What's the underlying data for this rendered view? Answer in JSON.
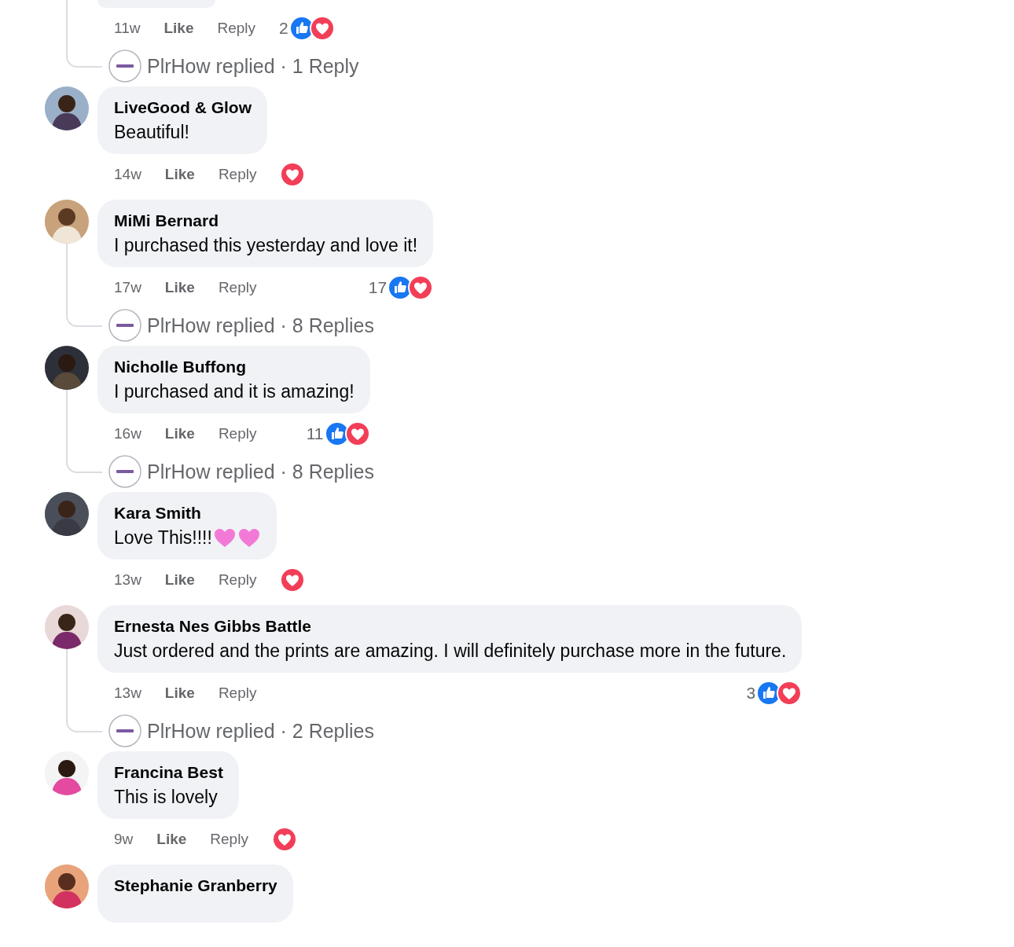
{
  "comments": [
    {
      "time": "11w",
      "actions": [
        "Like",
        "Reply"
      ],
      "reactions": {
        "count": "2",
        "like": true,
        "love": true
      },
      "reply_summary": {
        "text": "PlrHow replied · 1 Reply"
      }
    },
    {
      "name": "LiveGood & Glow",
      "text": "Beautiful!",
      "time": "14w",
      "actions": [
        "Like",
        "Reply"
      ],
      "reactions": {
        "like": false,
        "love": true
      }
    },
    {
      "name": "MiMi Bernard",
      "text": "I purchased this yesterday and love it!",
      "time": "17w",
      "actions": [
        "Like",
        "Reply"
      ],
      "reactions": {
        "count": "17",
        "like": true,
        "love": true
      },
      "reply_summary": {
        "text": "PlrHow replied · 8 Replies"
      }
    },
    {
      "name": "Nicholle Buffong",
      "text": "I purchased and it is amazing!",
      "time": "16w",
      "actions": [
        "Like",
        "Reply"
      ],
      "reactions": {
        "count": "11",
        "like": true,
        "love": true
      },
      "reply_summary": {
        "text": "PlrHow replied · 8 Replies"
      }
    },
    {
      "name": "Kara Smith",
      "text": "Love This!!!!",
      "hearts": true,
      "time": "13w",
      "actions": [
        "Like",
        "Reply"
      ],
      "reactions": {
        "like": false,
        "love": true
      }
    },
    {
      "name": "Ernesta Nes Gibbs Battle",
      "text": "Just ordered and the prints are amazing. I will definitely purchase more in the future.",
      "time": "13w",
      "actions": [
        "Like",
        "Reply"
      ],
      "reactions": {
        "count": "3",
        "like": true,
        "love": true
      },
      "reply_summary": {
        "text": "PlrHow replied · 2 Replies"
      }
    },
    {
      "name": "Francina Best",
      "text": "This is lovely",
      "time": "9w",
      "actions": [
        "Like",
        "Reply"
      ],
      "reactions": {
        "like": false,
        "love": true
      }
    },
    {
      "name": "Stephanie Granberry"
    }
  ]
}
